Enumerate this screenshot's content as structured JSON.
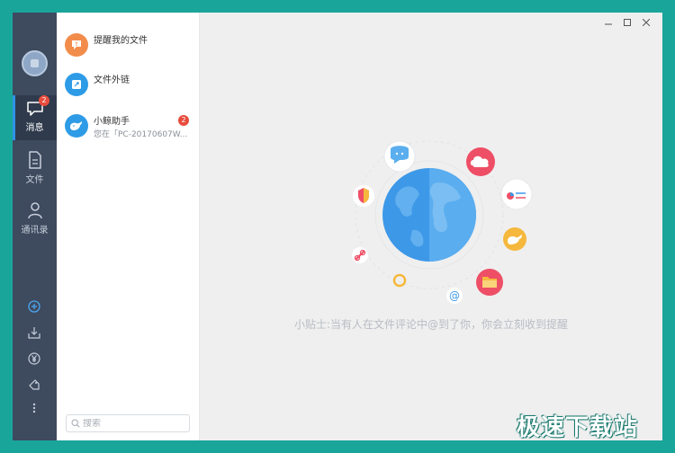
{
  "colors": {
    "outer_bg": "#1aa59a",
    "nav_bg": "#3e4a5e",
    "nav_active_bg": "#2f3a4c",
    "accent": "#2e93e6",
    "badge": "#e74c3c",
    "main_bg": "#efefef"
  },
  "nav": {
    "items": [
      {
        "label": "消息",
        "icon": "message-icon",
        "badge": "2",
        "active": true
      },
      {
        "label": "文件",
        "icon": "file-icon"
      },
      {
        "label": "通讯录",
        "icon": "contacts-icon"
      }
    ],
    "tools": [
      "add-circle-icon",
      "download-icon",
      "yen-icon",
      "tag-icon",
      "more-icon"
    ]
  },
  "list": {
    "conversations": [
      {
        "title": "提醒我的文件",
        "subtitle": "",
        "icon": "reminder-icon",
        "color": "#f28c4b"
      },
      {
        "title": "文件外链",
        "subtitle": "",
        "icon": "link-icon",
        "color": "#2e9be6"
      },
      {
        "title": "小鲸助手",
        "subtitle": "您在「PC-20170607W...",
        "icon": "whale-icon",
        "color": "#2e9be6",
        "badge": "2"
      }
    ],
    "search_placeholder": "搜索"
  },
  "main": {
    "tip": "小贴士:当有人在文件评论中@到了你，你会立刻收到提醒"
  },
  "watermark": "极速下载站"
}
